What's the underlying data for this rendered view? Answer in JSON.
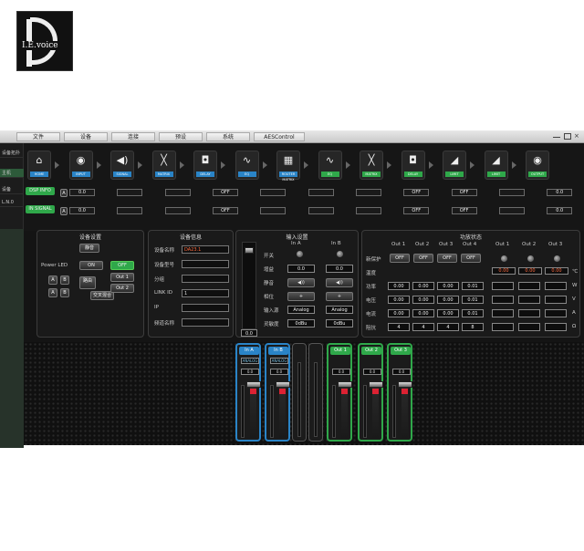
{
  "logo": {
    "text": "I.E.voice"
  },
  "menu": [
    "文件",
    "设备",
    "连接",
    "预设",
    "系统",
    "AESControl"
  ],
  "sidebar": {
    "top_label": "设备拓扑",
    "items": [
      "主机",
      "设备",
      "L.N.0"
    ]
  },
  "left_tags": [
    "DSP INFO",
    "IN SIGNAL"
  ],
  "chain": [
    {
      "label": "HOME",
      "icon": "home-icon",
      "color": "#2a84c7"
    },
    {
      "label": "INPUT",
      "icon": "xlr-icon",
      "color": "#2a84c7"
    },
    {
      "label": "SIGNAL",
      "icon": "speaker-icon",
      "color": "#2a84c7"
    },
    {
      "label": "MATRIX",
      "icon": "cross-icon",
      "color": "#2a84c7"
    },
    {
      "label": "DELAY",
      "icon": "delay-icon",
      "color": "#2a84c7"
    },
    {
      "label": "EQ",
      "icon": "eq-icon",
      "color": "#2a84c7"
    },
    {
      "label": "ROUTER MATRIX",
      "icon": "grid-icon",
      "color": "#2a84c7"
    },
    {
      "label": "EQ",
      "icon": "eq-icon",
      "color": "#2fa84a"
    },
    {
      "label": "MATRIX",
      "icon": "cross-icon",
      "color": "#2fa84a"
    },
    {
      "label": "DELAY",
      "icon": "delay-icon",
      "color": "#2fa84a"
    },
    {
      "label": "LIMIT",
      "icon": "limit-icon",
      "color": "#2fa84a"
    },
    {
      "label": "LIMIT",
      "icon": "limit-icon",
      "color": "#2fa84a"
    },
    {
      "label": "OUTPUT",
      "icon": "xlr-icon",
      "color": "#2fa84a"
    }
  ],
  "chain_rows": {
    "row1": [
      "0.0",
      "",
      "",
      "OFF",
      "",
      "",
      "",
      "OFF",
      "OFF",
      "",
      "0.0"
    ],
    "row2": [
      "0.0",
      "",
      "",
      "OFF",
      "",
      "",
      "",
      "OFF",
      "OFF",
      "",
      "0.0"
    ],
    "tags": [
      "A",
      "A"
    ]
  },
  "device_settings": {
    "title": "设备设置",
    "name_btn": "静音",
    "power_label": "Power LED",
    "on": "ON",
    "off": "OFF",
    "io": [
      "A",
      "B",
      "A",
      "B"
    ],
    "mid": [
      "路由",
      "",
      "交叉混合"
    ],
    "outs": [
      "Out 1",
      "Out 2"
    ]
  },
  "device_info": {
    "title": "设备信息",
    "rows": [
      {
        "label": "设备名称",
        "value": "DA23.1"
      },
      {
        "label": "设备型号",
        "value": ""
      },
      {
        "label": "分组",
        "value": ""
      },
      {
        "label": "LINK ID",
        "value": "1"
      },
      {
        "label": "IP",
        "value": ""
      },
      {
        "label": "频道名称",
        "value": ""
      }
    ]
  },
  "input_settings": {
    "title": "输入设置",
    "cols": [
      "In A",
      "In B"
    ],
    "rows": [
      {
        "label": "开关",
        "a": "",
        "b": ""
      },
      {
        "label": "增益",
        "a": "0.0",
        "b": "0.0"
      },
      {
        "label": "静音",
        "a": "◀))",
        "b": "◀))"
      },
      {
        "label": "相位",
        "a": "+",
        "b": "+"
      },
      {
        "label": "输入源",
        "a": "Analog",
        "b": "Analog"
      },
      {
        "label": "灵敏度",
        "a": "0dBu",
        "b": "0dBu"
      }
    ],
    "master_value": "0.0"
  },
  "function_status": {
    "title": "功放状态",
    "out_cols": [
      "Out 1",
      "Out 2",
      "Out 3",
      "Out 4"
    ],
    "right_cols": [
      "Out 1",
      "Out 2",
      "Out 3"
    ],
    "new_label": "新保护",
    "off": [
      "OFF",
      "OFF",
      "OFF",
      "OFF"
    ],
    "temp_label": "温度",
    "temps": [
      "0.00",
      "0.00",
      "0.00"
    ],
    "unit_c": "℃",
    "rows": [
      {
        "label": "功率",
        "values": [
          "0.00",
          "0.00",
          "0.00",
          "0.01"
        ],
        "unit": "W"
      },
      {
        "label": "电压",
        "values": [
          "0.00",
          "0.00",
          "0.00",
          "0.01"
        ],
        "unit": "V"
      },
      {
        "label": "电流",
        "values": [
          "0.00",
          "0.00",
          "0.00",
          "0.01"
        ],
        "unit": "A"
      },
      {
        "label": "阻抗",
        "values": [
          "4",
          "4",
          "4",
          "8"
        ],
        "unit": "Ω"
      }
    ]
  },
  "mixer": {
    "strips": [
      {
        "name": "In A",
        "color": "#2a84c7",
        "sub": "ANALOG"
      },
      {
        "name": "In B",
        "color": "#2a84c7",
        "sub": "ANALOG"
      },
      {
        "name": "",
        "color": "#444",
        "sub": ""
      },
      {
        "name": "",
        "color": "#444",
        "sub": ""
      },
      {
        "name": "Out 1",
        "color": "#2fa84a",
        "sub": ""
      },
      {
        "name": "Out 2",
        "color": "#2fa84a",
        "sub": ""
      },
      {
        "name": "Out 3",
        "color": "#2fa84a",
        "sub": ""
      }
    ],
    "db": [
      "0.0",
      "0.0",
      "",
      "",
      "0.0",
      "0.0",
      "0.0"
    ]
  }
}
